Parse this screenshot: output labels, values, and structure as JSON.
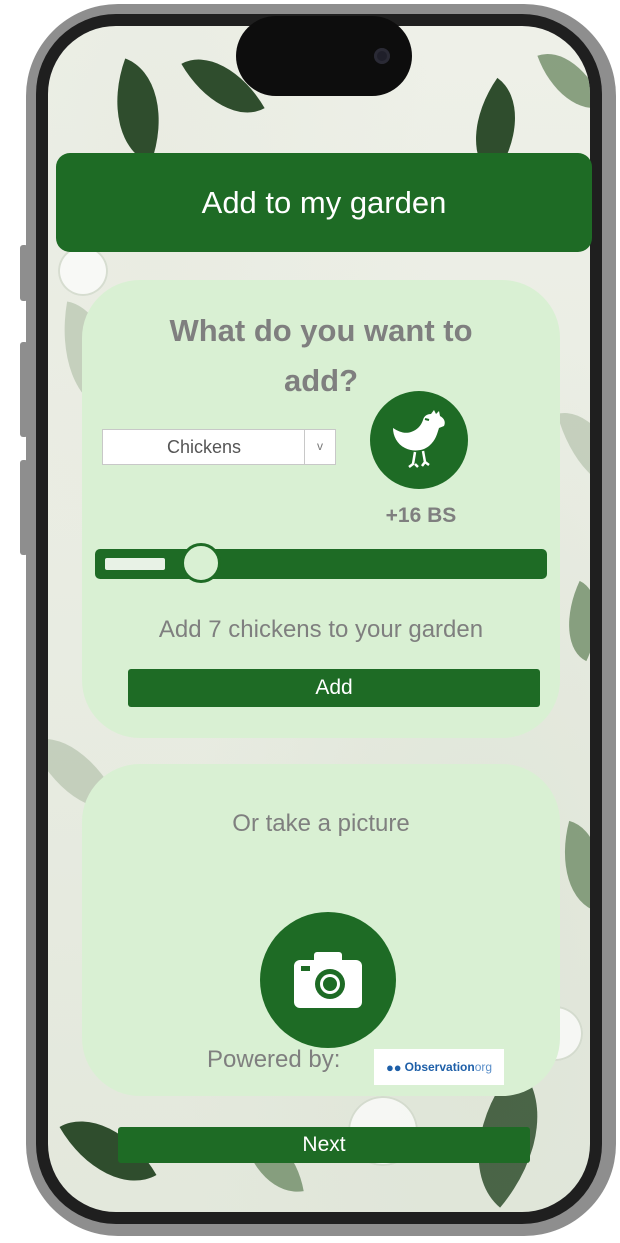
{
  "header": {
    "title": "Add to my garden"
  },
  "add_section": {
    "question": "What do you want to add?",
    "animal_select": {
      "value": "Chickens",
      "arrow": "v"
    },
    "animal_icon": "chicken-icon",
    "bonus_label": "+16 BS",
    "quantity_slider": {
      "value": 7
    },
    "summary": "Add 7 chickens to your garden",
    "add_button": "Add"
  },
  "photo_section": {
    "prompt": "Or take a picture",
    "camera_icon": "camera-icon",
    "powered_by": "Powered by:",
    "partner_logo": {
      "name": "Observation",
      "suffix": "org"
    }
  },
  "footer": {
    "next_button": "Next"
  },
  "colors": {
    "primary": "#1e6b25",
    "card": "#d9f0d3",
    "text_muted": "#7f7f7f"
  }
}
